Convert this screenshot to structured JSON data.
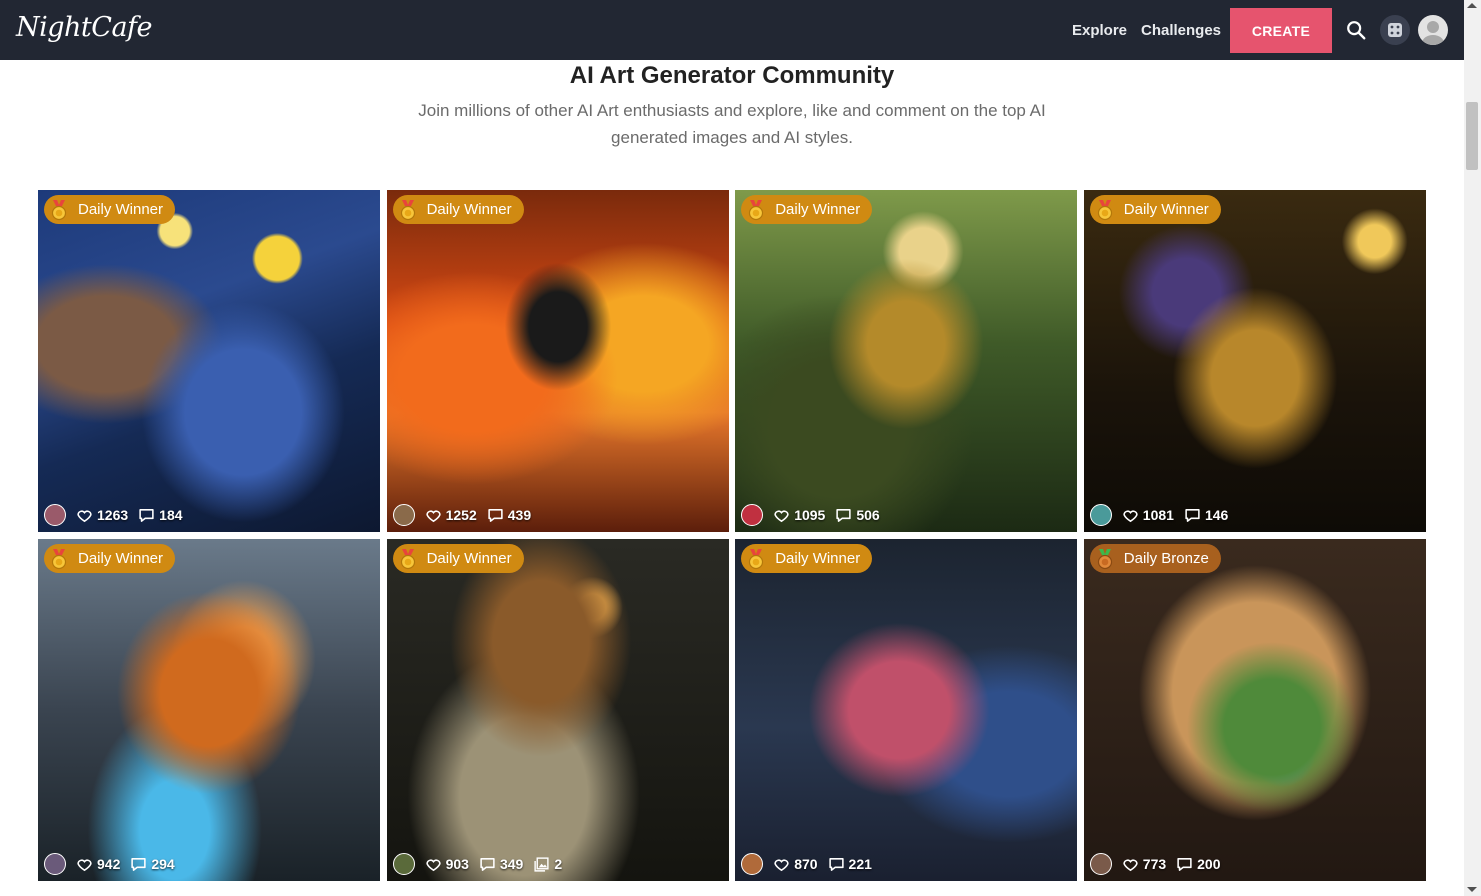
{
  "header": {
    "logo": "NightCafe",
    "nav": {
      "explore": "Explore",
      "challenges": "Challenges"
    },
    "create_label": "CREATE",
    "icons": {
      "search": "search-icon",
      "random": "dice-icon",
      "avatar": "user-avatar-icon"
    }
  },
  "main": {
    "title": "AI Art Generator Community",
    "subtitle": "Join millions of other AI Art enthusiasts and explore, like and comment on the top AI generated images and AI styles."
  },
  "cards": [
    {
      "badge": "Daily Winner",
      "badge_color": "#d08a12",
      "likes": "1263",
      "comments": "184",
      "avatar_color": "#9a5a6a"
    },
    {
      "badge": "Daily Winner",
      "badge_color": "#d08a12",
      "likes": "1252",
      "comments": "439",
      "avatar_color": "#8a6a4a"
    },
    {
      "badge": "Daily Winner",
      "badge_color": "#d08a12",
      "likes": "1095",
      "comments": "506",
      "avatar_color": "#c03040"
    },
    {
      "badge": "Daily Winner",
      "badge_color": "#d08a12",
      "likes": "1081",
      "comments": "146",
      "avatar_color": "#4a9a9a"
    },
    {
      "badge": "Daily Winner",
      "badge_color": "#d08a12",
      "likes": "942",
      "comments": "294",
      "avatar_color": "#6a5a7a"
    },
    {
      "badge": "Daily Winner",
      "badge_color": "#d08a12",
      "likes": "903",
      "comments": "349",
      "collections": "2",
      "avatar_color": "#5a6a3a"
    },
    {
      "badge": "Daily Winner",
      "badge_color": "#d08a12",
      "likes": "870",
      "comments": "221",
      "avatar_color": "#b06a3a"
    },
    {
      "badge": "Daily Bronze",
      "badge_color": "#a8601e",
      "likes": "773",
      "comments": "200",
      "avatar_color": "#7a5a4a"
    }
  ],
  "colors": {
    "topbar": "#222733",
    "accent": "#e6546e"
  }
}
